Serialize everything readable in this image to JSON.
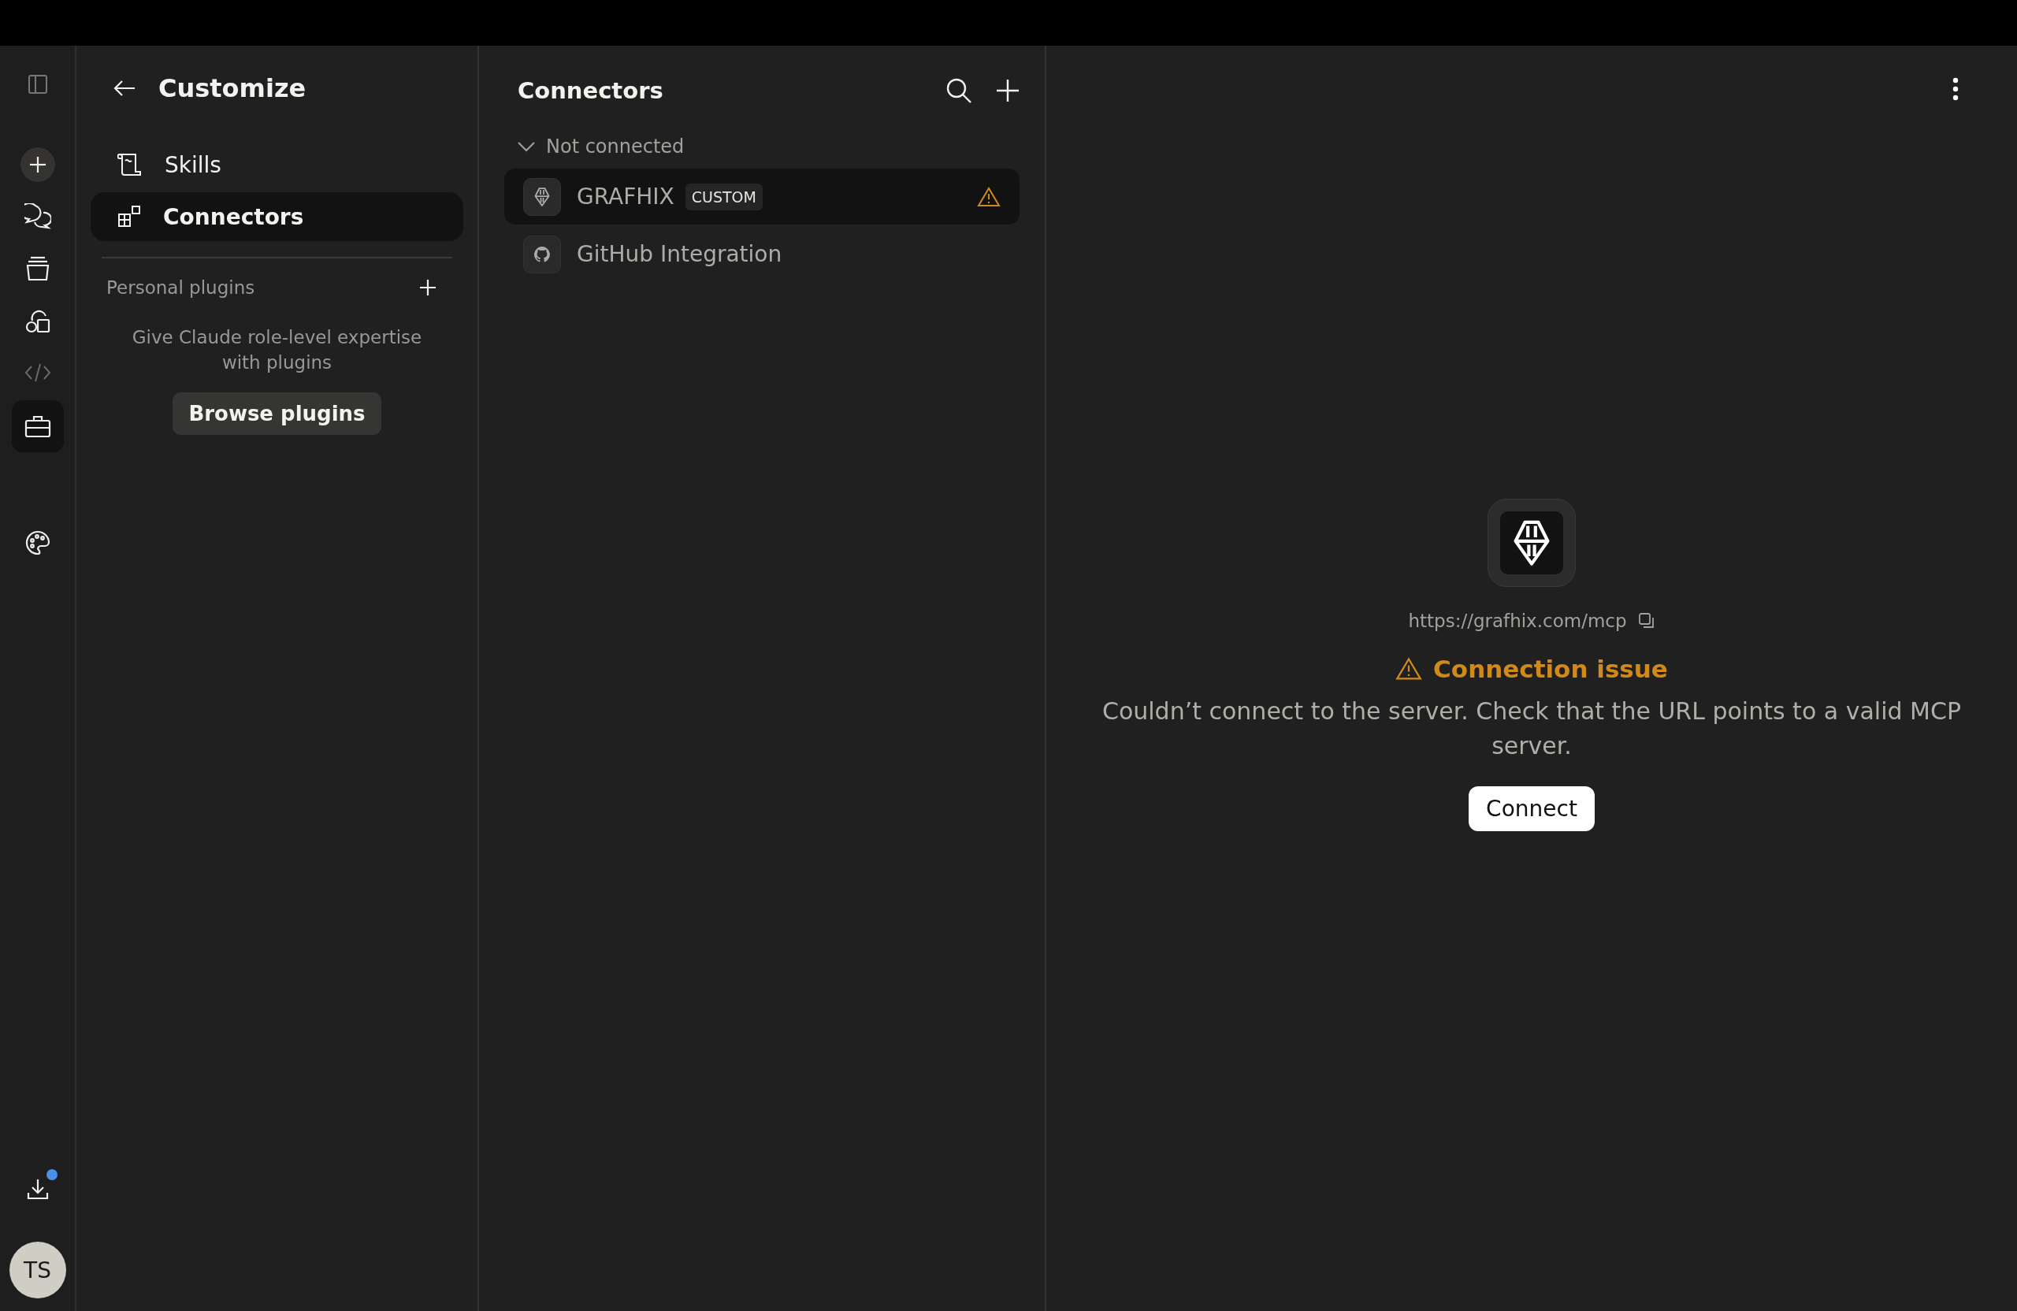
{
  "rail": {
    "items": [
      {
        "kind": "sidebar",
        "selected": false,
        "disabled": false
      },
      {
        "kind": "new",
        "selected": false,
        "disabled": false
      },
      {
        "kind": "chats",
        "selected": false,
        "disabled": false
      },
      {
        "kind": "projects",
        "selected": false,
        "disabled": false
      },
      {
        "kind": "artifacts",
        "selected": false,
        "disabled": false
      },
      {
        "kind": "code",
        "selected": false,
        "disabled": true
      },
      {
        "kind": "customize",
        "selected": true,
        "disabled": false
      },
      {
        "kind": "palette",
        "selected": false,
        "disabled": false
      }
    ],
    "download": {
      "notification": true
    },
    "avatar": {
      "initials": "TS"
    }
  },
  "customize": {
    "title": "Customize",
    "nav": [
      {
        "kind": "skills",
        "label": "Skills",
        "selected": false
      },
      {
        "kind": "connectors",
        "label": "Connectors",
        "selected": true
      }
    ],
    "plugins": {
      "heading": "Personal plugins",
      "description": "Give Claude role-level expertise with plugins",
      "button": "Browse plugins"
    }
  },
  "connectors": {
    "title": "Connectors",
    "group": {
      "label": "Not connected",
      "expanded": true
    },
    "items": [
      {
        "kind": "grafix",
        "name": "GRAFHIX",
        "tag": "CUSTOM",
        "warning": true,
        "selected": true
      },
      {
        "kind": "github",
        "name": "GitHub Integration",
        "warning": false,
        "selected": false
      }
    ]
  },
  "detail": {
    "url": "https://grafhix.com/mcp",
    "status": "Connection issue",
    "message": "Couldn’t connect to the server. Check that the URL points to a valid MCP server.",
    "button": "Connect"
  }
}
